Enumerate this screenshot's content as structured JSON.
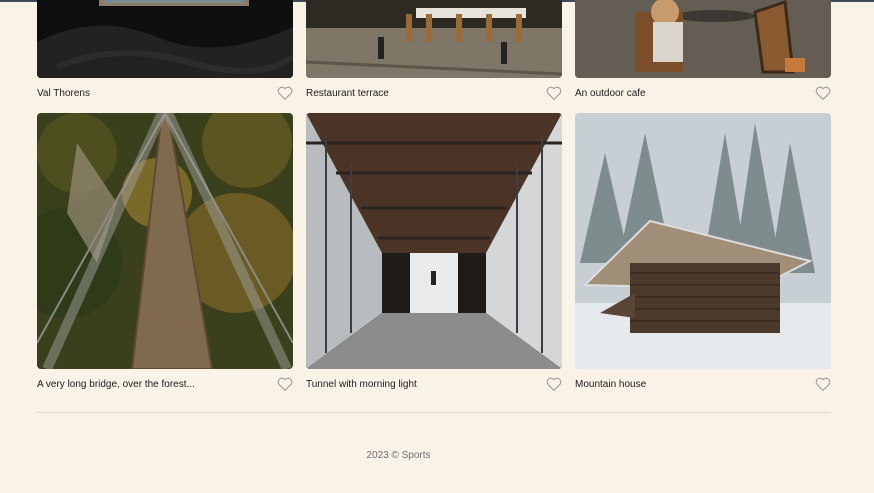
{
  "cards": [
    {
      "title": "Val Thorens",
      "liked": false
    },
    {
      "title": "Restaurant terrace",
      "liked": false
    },
    {
      "title": "An outdoor cafe",
      "liked": false
    },
    {
      "title": "A very long bridge, over the forest...",
      "liked": false
    },
    {
      "title": "Tunnel with morning light",
      "liked": false
    },
    {
      "title": "Mountain house",
      "liked": false
    }
  ],
  "icons": {
    "like": "heart-outline-icon"
  },
  "footer": {
    "text": "2023 © Sports"
  },
  "colors": {
    "background": "#f9f2e6",
    "text": "#1d1d1d",
    "icon": "#9a9a9a"
  }
}
